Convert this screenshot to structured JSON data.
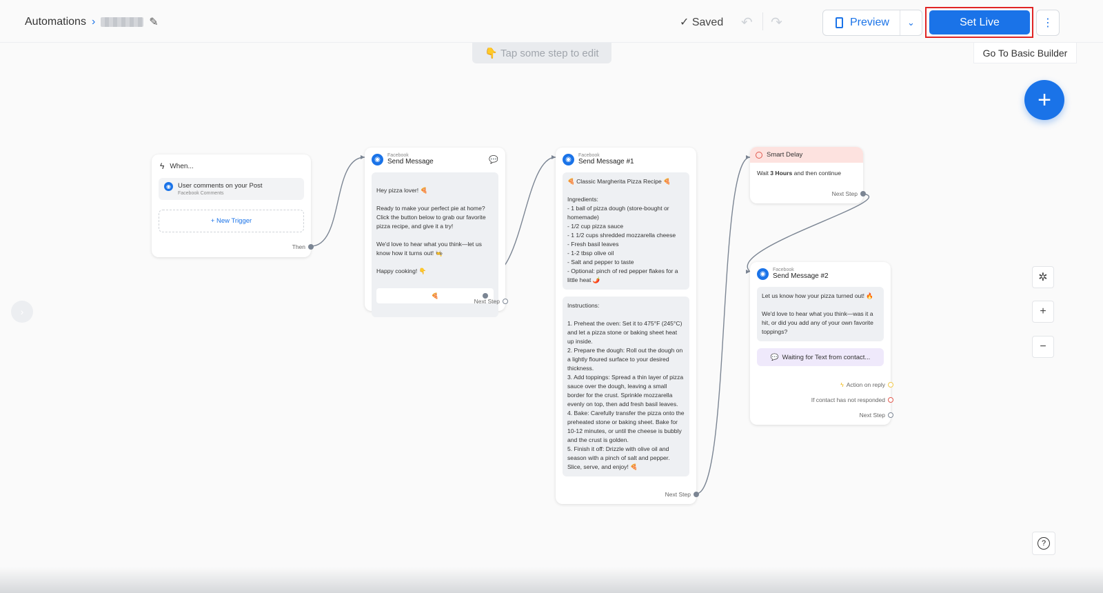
{
  "header": {
    "breadcrumb_root": "Automations",
    "saved_label": "Saved",
    "preview_label": "Preview",
    "set_live_label": "Set Live"
  },
  "hint": "👇 Tap some step to edit",
  "go_basic_builder": "Go To Basic Builder",
  "trigger_card": {
    "title": "When...",
    "trigger_label": "User comments on your Post",
    "trigger_source": "Facebook Comments",
    "new_trigger": "+ New Trigger",
    "then_label": "Then"
  },
  "send_message_1": {
    "channel": "Facebook",
    "title": "Send Message",
    "text": "Hey pizza lover! 🍕\n\nReady to make your perfect pie at home? Click the button below to grab our favorite pizza recipe, and give it a try!\n\nWe'd love to hear what you think—let us know how it turns out! 🧑‍🍳\n\nHappy cooking! 👇",
    "button_label": "🍕",
    "next_step": "Next Step"
  },
  "send_message_2": {
    "channel": "Facebook",
    "title": "Send Message #1",
    "text1": "🍕 Classic Margherita Pizza Recipe 🍕\n\nIngredients:\n- 1 ball of pizza dough (store-bought or homemade)\n- 1/2 cup pizza sauce\n- 1 1/2 cups shredded mozzarella cheese\n- Fresh basil leaves\n- 1-2 tbsp olive oil\n- Salt and pepper to taste\n- Optional: pinch of red pepper flakes for a little heat 🌶️",
    "text2": "Instructions:\n\n1. Preheat the oven: Set it to 475°F (245°C) and let a pizza stone or baking sheet heat up inside.\n2. Prepare the dough: Roll out the dough on a lightly floured surface to your desired thickness.\n3. Add toppings: Spread a thin layer of pizza sauce over the dough, leaving a small border for the crust. Sprinkle mozzarella evenly on top, then add fresh basil leaves.\n4. Bake: Carefully transfer the pizza onto the preheated stone or baking sheet. Bake for 10-12 minutes, or until the cheese is bubbly and the crust is golden.\n5. Finish it off: Drizzle with olive oil and season with a pinch of salt and pepper. Slice, serve, and enjoy! 🍕",
    "next_step": "Next Step"
  },
  "smart_delay": {
    "title": "Smart Delay",
    "wait_prefix": "Wait ",
    "wait_value": "3 Hours",
    "wait_suffix": " and then continue",
    "next_step": "Next Step"
  },
  "send_message_3": {
    "channel": "Facebook",
    "title": "Send Message #2",
    "text": "Let us know how your pizza turned out! 🔥\n\nWe'd love to hear what you think—was it a hit, or did you add any of your own favorite toppings?",
    "waiting_label": "Waiting for Text from contact...",
    "action_on_reply": "Action on reply",
    "not_responded": "If contact has not responded",
    "next_step": "Next Step"
  },
  "colors": {
    "accent": "#1a73e8",
    "highlight_border": "#e02424",
    "delay_header": "#fde2df",
    "waiting_bg": "#efe9fb"
  }
}
